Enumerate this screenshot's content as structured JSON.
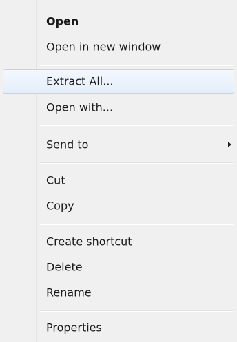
{
  "context_menu": {
    "items": [
      {
        "label": "Open",
        "bold": true
      },
      {
        "label": "Open in new window"
      },
      {
        "label": "Extract All...",
        "highlighted": true
      },
      {
        "label": "Open with..."
      },
      {
        "label": "Send to",
        "submenu": true
      },
      {
        "label": "Cut"
      },
      {
        "label": "Copy"
      },
      {
        "label": "Create shortcut"
      },
      {
        "label": "Delete"
      },
      {
        "label": "Rename"
      },
      {
        "label": "Properties"
      }
    ],
    "highlight_color": "#e4eefb",
    "highlight_border": "#b8d6fb"
  }
}
